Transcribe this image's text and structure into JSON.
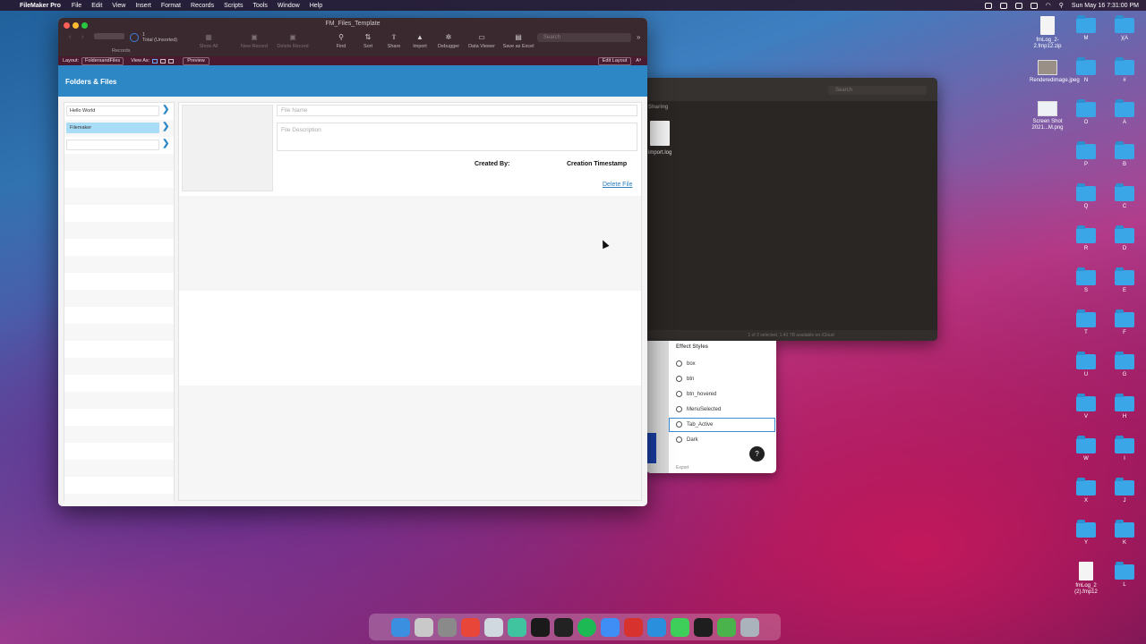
{
  "menubar": {
    "app_name": "FileMaker Pro",
    "items": [
      "File",
      "Edit",
      "View",
      "Insert",
      "Format",
      "Records",
      "Scripts",
      "Tools",
      "Window",
      "Help"
    ],
    "clock": "Sun May 16  7:31:00 PM"
  },
  "window": {
    "title": "FM_Files_Template",
    "record_count": "1",
    "record_status": "Total (Unsorted)",
    "records_label": "Records",
    "toolbar": {
      "show_all": "Show All",
      "new_record": "New Record",
      "delete_record": "Delete Record",
      "find": "Find",
      "sort": "Sort",
      "share": "Share",
      "import": "Import",
      "debugger": "Debugger",
      "data_viewer": "Data Viewer",
      "save_as_excel": "Save as Excel",
      "search_placeholder": "Search"
    },
    "layoutbar": {
      "layout_label": "Layout:",
      "layout_value": "FoldersandFiles",
      "view_as_label": "View As:",
      "preview": "Preview",
      "font_icon_text": "Aᵃ",
      "edit_layout": "Edit Layout"
    },
    "header_title": "Folders & Files",
    "folders": [
      {
        "name": "Hello World",
        "active": false
      },
      {
        "name": "Filemaker",
        "active": true
      },
      {
        "name": "",
        "active": false
      }
    ],
    "file_form": {
      "file_name_placeholder": "File Name",
      "file_description_placeholder": "File Description",
      "created_by_label": "Created By:",
      "creation_timestamp_label": "Creation Timestamp",
      "delete_link": "Delete File"
    }
  },
  "finder": {
    "search_placeholder": "Search",
    "sidebar_label": "Sharing",
    "file_name": "import.log",
    "status": "1 of 3 selected, 1.41 TB available on iCloud"
  },
  "styles_panel": {
    "title": "Effect Styles",
    "items": [
      "box",
      "btn",
      "btn_hovered",
      "MenuSelected",
      "Tab_Active",
      "Dark"
    ],
    "footer": "Export",
    "help": "?"
  },
  "desktop": {
    "files": [
      {
        "label": "fmLog_2-2.fmp12.zip"
      },
      {
        "label": "Renderedimage.jpeg"
      },
      {
        "label": "Screen Shot 2021...M.png"
      },
      {
        "label": "fmLog_2 (2).fmp12"
      }
    ],
    "folders_col1": [
      "M",
      "N",
      "O",
      "P",
      "Q",
      "R",
      "S",
      "T",
      "U",
      "V",
      "W",
      "X",
      "Y"
    ],
    "folders_col2": [
      ")(A",
      "#",
      "A",
      "B",
      "C",
      "D",
      "E",
      "F",
      "G",
      "H",
      "I",
      "J",
      "K",
      "L"
    ]
  }
}
